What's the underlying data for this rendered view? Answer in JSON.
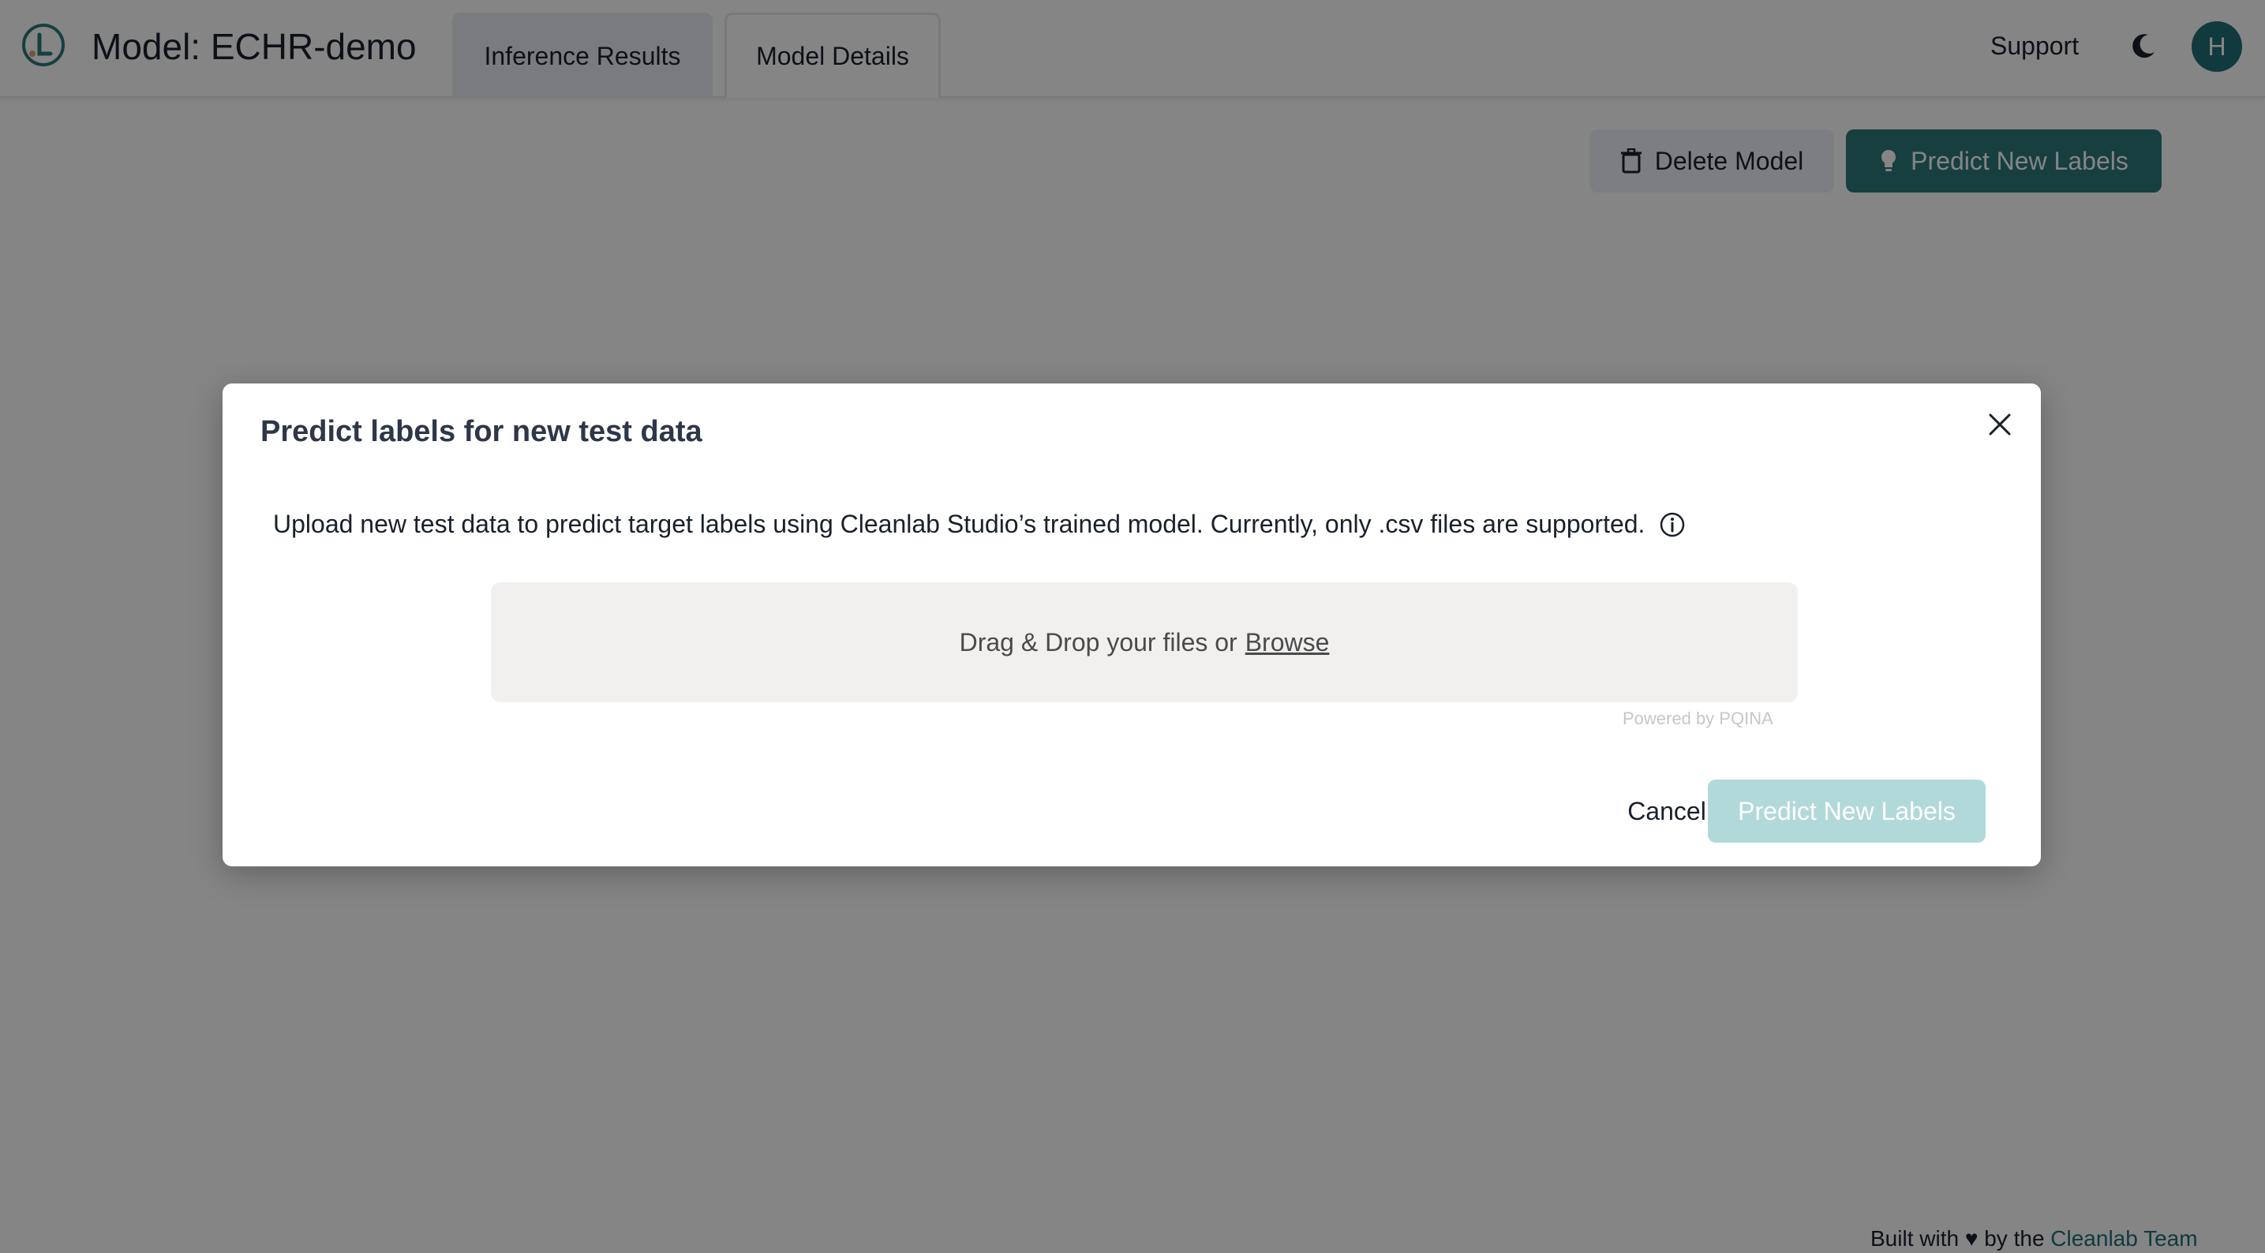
{
  "header": {
    "title": "Model: ECHR-demo",
    "tabs": [
      {
        "label": "Inference Results",
        "active": true
      },
      {
        "label": "Model Details",
        "active": false
      }
    ],
    "support_label": "Support",
    "avatar_initial": "H",
    "theme_icon": "moon-icon",
    "logo_icon": "cleanlab-logo"
  },
  "toolbar": {
    "delete_label": "Delete Model",
    "delete_icon": "trash-icon",
    "predict_label": "Predict New Labels",
    "predict_icon": "lightbulb-icon"
  },
  "modal": {
    "title": "Predict labels for new test data",
    "description": "Upload new test data to predict target labels using Cleanlab Studio’s trained model. Currently, only .csv files are supported.",
    "dropzone_text": "Drag & Drop your files or",
    "browse_label": "Browse",
    "powered_by": "Powered by PQINA",
    "cancel_label": "Cancel",
    "submit_label": "Predict New Labels"
  },
  "footer": {
    "prefix": "Built with",
    "middle": "by the",
    "link_label": "Cleanlab Team"
  },
  "colors": {
    "accent": "#2c7a7b",
    "accent_disabled": "#b2d9da",
    "avatar_bg": "#1f6f77"
  }
}
